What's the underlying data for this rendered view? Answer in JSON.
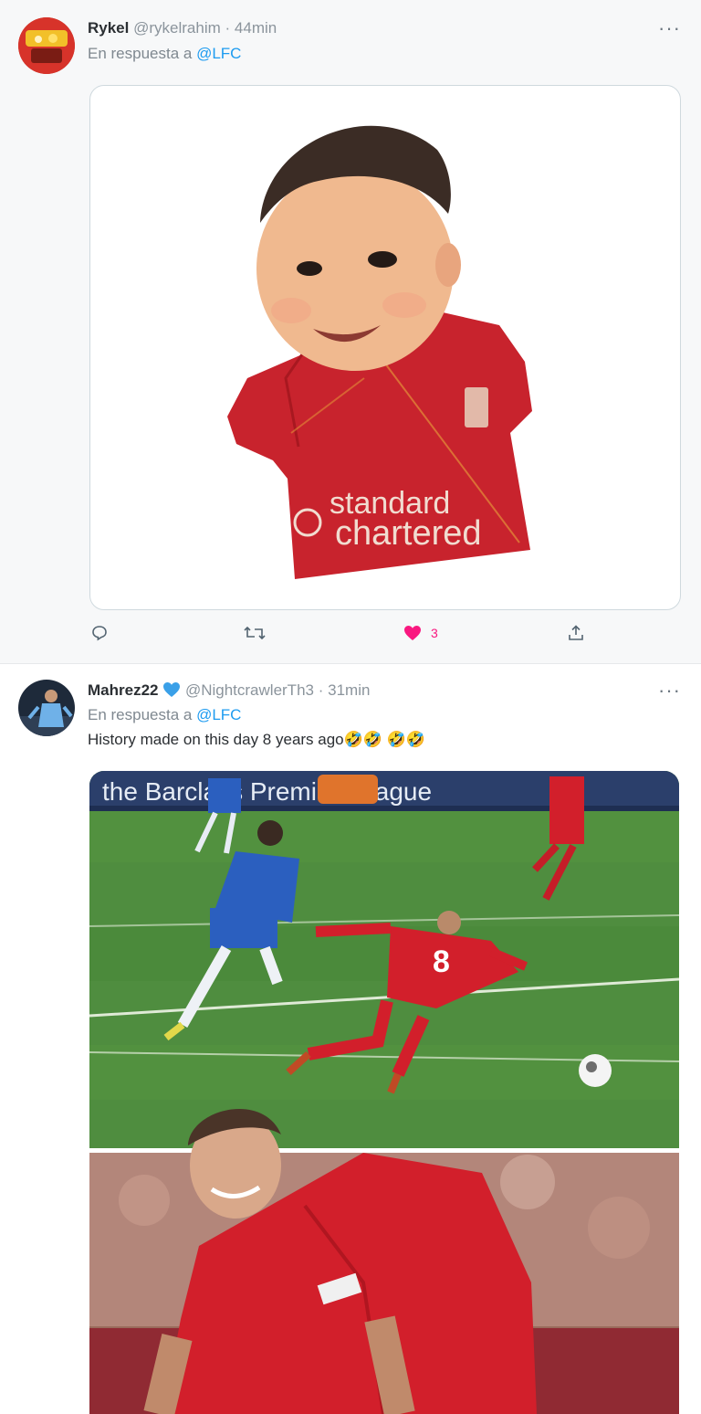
{
  "tweets": [
    {
      "name": "Rykel",
      "handle": "@rykelrahim",
      "separator": "·",
      "time": "44min",
      "reply_prefix": "En respuesta a ",
      "reply_to": "@LFC",
      "more": "···",
      "shirt_text_line1": "standard",
      "shirt_text_line2": "chartered",
      "actions": {
        "reply_count": "",
        "retweet_count": "",
        "like_count": "3"
      }
    },
    {
      "name": "Mahrez22",
      "verified": true,
      "handle": "@NightcrawlerTh3",
      "separator": "·",
      "time": "31min",
      "reply_prefix": "En respuesta a ",
      "reply_to": "@LFC",
      "more": "···",
      "text": "History made on this day 8 years ago🤣🤣 🤣🤣",
      "board_text": "the Barclays Premier League"
    }
  ],
  "colors": {
    "accent": "#1d9bf0",
    "like": "#f91880",
    "lfc_red": "#d21f2b",
    "chelsea_blue": "#2b5fbf",
    "pitch": "#4b8a3c"
  }
}
